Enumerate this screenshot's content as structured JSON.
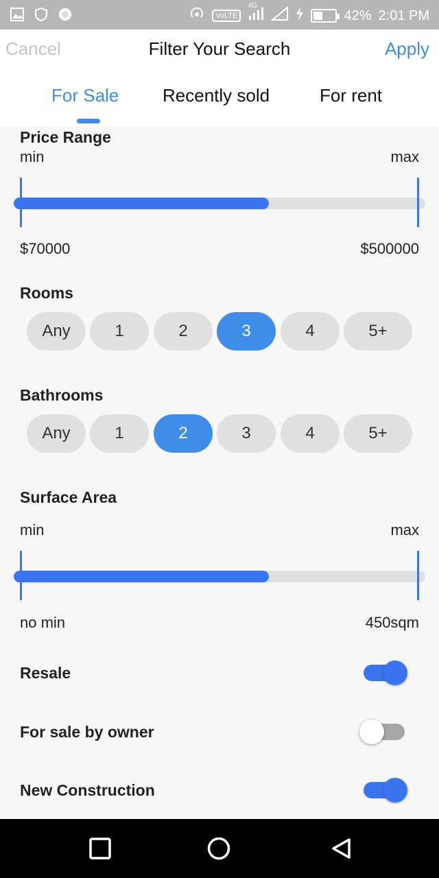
{
  "status_bar": {
    "network_badge": "VoLTE",
    "signal_label": "4G",
    "battery": "42%",
    "battery_level": 0.42,
    "time": "2:01 PM",
    "icons": [
      "image-icon",
      "shield-icon",
      "circle-icon",
      "hotspot-icon",
      "signal-icon",
      "wifi-icon",
      "charging-icon",
      "battery-icon"
    ]
  },
  "header": {
    "cancel": "Cancel",
    "title": "Filter Your Search",
    "apply": "Apply"
  },
  "tabs": [
    {
      "label": "For Sale",
      "active": true
    },
    {
      "label": "Recently sold",
      "active": false
    },
    {
      "label": "For rent",
      "active": false
    }
  ],
  "price_range": {
    "title": "Price Range",
    "min_label": "min",
    "max_label": "max",
    "min_value": "$70000",
    "max_value": "$500000",
    "fill_fraction": 0.62
  },
  "rooms": {
    "title": "Rooms",
    "options": [
      "Any",
      "1",
      "2",
      "3",
      "4",
      "5+"
    ],
    "selected": "3"
  },
  "bathrooms": {
    "title": "Bathrooms",
    "options": [
      "Any",
      "1",
      "2",
      "3",
      "4",
      "5+"
    ],
    "selected": "2"
  },
  "surface_area": {
    "title": "Surface Area",
    "min_label": "min",
    "max_label": "max",
    "min_value": "no min",
    "max_value": "450sqm",
    "fill_fraction": 0.62
  },
  "toggles": [
    {
      "label": "Resale",
      "on": true
    },
    {
      "label": "For sale by owner",
      "on": false
    },
    {
      "label": "New Construction",
      "on": true
    }
  ],
  "colors": {
    "accent": "#3f8de9",
    "slider_fill": "#3a75ef",
    "chip_bg": "#e0e0e0",
    "status_bar": "#b7b7b7"
  },
  "nav_icons": [
    "recents-icon",
    "home-icon",
    "back-icon"
  ]
}
